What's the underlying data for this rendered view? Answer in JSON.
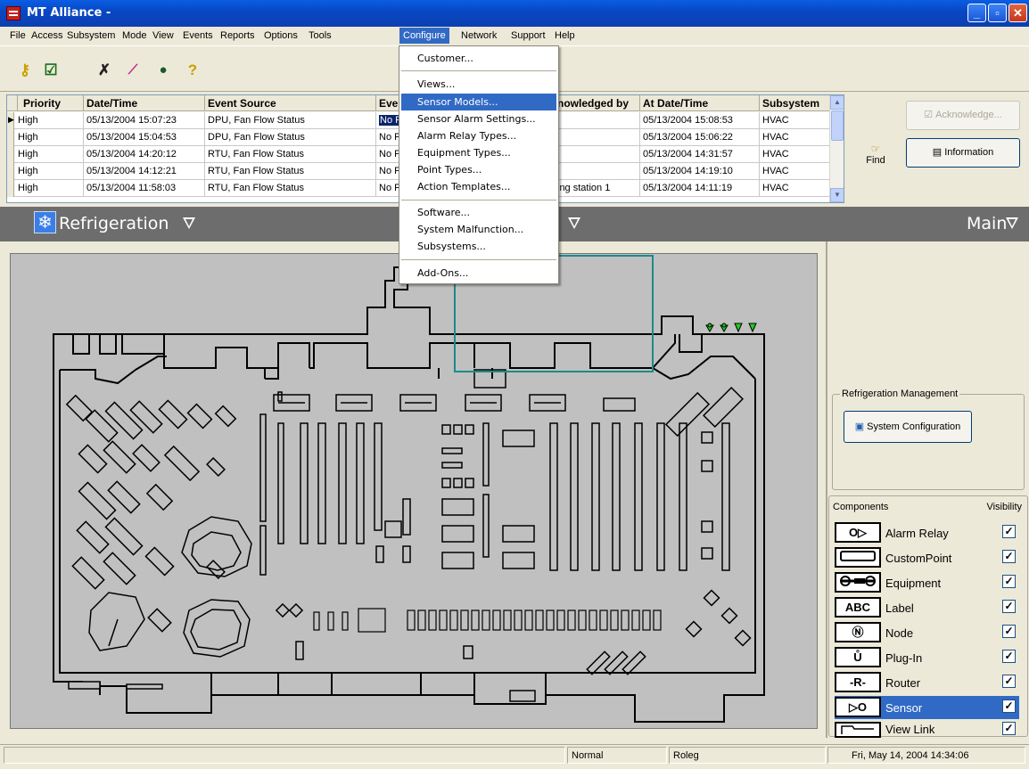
{
  "window": {
    "title": "MT Alliance -"
  },
  "menubar": {
    "items": [
      "File",
      "Access",
      "Subsystem",
      "Mode",
      "View",
      "Events",
      "Reports",
      "Options",
      "Tools",
      "Configure",
      "Network",
      "Support",
      "Help"
    ],
    "active": "Configure"
  },
  "toolbar": {
    "icons": [
      "key-icon",
      "checkmark-icon",
      "cross-icon",
      "trend-chart-icon",
      "globe-icon",
      "help-icon"
    ]
  },
  "event_grid": {
    "columns": [
      "Priority",
      "Date/Time",
      "Event Source",
      "Eve",
      "nowledged by",
      "At Date/Time",
      "Subsystem"
    ],
    "rows": [
      {
        "priority": "High",
        "datetime": "05/13/2004 15:07:23",
        "source": "DPU, Fan Flow Status",
        "event": "No F",
        "ack_by": "",
        "at_datetime": "05/13/2004 15:08:53",
        "subsystem": "HVAC"
      },
      {
        "priority": "High",
        "datetime": "05/13/2004 15:04:53",
        "source": "DPU, Fan Flow Status",
        "event": "No F",
        "ack_by": "",
        "at_datetime": "05/13/2004 15:06:22",
        "subsystem": "HVAC"
      },
      {
        "priority": "High",
        "datetime": "05/13/2004 14:20:12",
        "source": "RTU, Fan Flow Status",
        "event": "No F",
        "ack_by": "",
        "at_datetime": "05/13/2004 14:31:57",
        "subsystem": "HVAC"
      },
      {
        "priority": "High",
        "datetime": "05/13/2004 14:12:21",
        "source": "RTU, Fan Flow Status",
        "event": "No F",
        "ack_by": "",
        "at_datetime": "05/13/2004 14:19:10",
        "subsystem": "HVAC"
      },
      {
        "priority": "High",
        "datetime": "05/13/2004 11:58:03",
        "source": "RTU, Fan Flow Status",
        "event": "No F",
        "ack_by": "ing station 1",
        "at_datetime": "05/13/2004 14:11:19",
        "subsystem": "HVAC"
      }
    ]
  },
  "actions": {
    "acknowledge": "Acknowledge...",
    "information": "Information",
    "find": "Find"
  },
  "viewbar": {
    "left_view": "Refrigeration",
    "right_view": "Main"
  },
  "configure_menu": {
    "groups": [
      [
        "Customer..."
      ],
      [
        "Views...",
        "Sensor Models...",
        "Sensor Alarm Settings...",
        "Alarm Relay Types...",
        "Equipment Types...",
        "Point Types...",
        "Action Templates..."
      ],
      [
        "Software...",
        "System Malfunction...",
        "Subsystems..."
      ],
      [
        "Add-Ons..."
      ]
    ],
    "highlighted": "Sensor Models..."
  },
  "refrigeration_management": {
    "title": "Refrigeration Management",
    "system_configuration": "System Configuration"
  },
  "components": {
    "header_components": "Components",
    "header_visibility": "Visibility",
    "items": [
      {
        "label": "Alarm Relay",
        "icon": "alarm-relay-icon",
        "glyph": "O▷",
        "visible": true
      },
      {
        "label": "CustomPoint",
        "icon": "custom-point-icon",
        "glyph": "",
        "visible": true
      },
      {
        "label": "Equipment",
        "icon": "equipment-icon",
        "glyph": "",
        "visible": true
      },
      {
        "label": "Label",
        "icon": "label-icon",
        "glyph": "ABC",
        "visible": true
      },
      {
        "label": "Node",
        "icon": "node-icon",
        "glyph": "Ⓝ",
        "visible": true
      },
      {
        "label": "Plug-In",
        "icon": "plug-in-icon",
        "glyph": "Ů",
        "visible": true
      },
      {
        "label": "Router",
        "icon": "router-icon",
        "glyph": "-R-",
        "visible": true
      },
      {
        "label": "Sensor",
        "icon": "sensor-icon",
        "glyph": "▷O",
        "visible": true
      },
      {
        "label": "View Link",
        "icon": "view-link-icon",
        "glyph": "",
        "visible": true
      }
    ],
    "selected": "Sensor"
  },
  "statusbar": {
    "mode": "Normal",
    "user": "Roleg",
    "datetime": "Fri, May 14, 2004  14:34:06"
  },
  "colors": {
    "title_bar": "#0a5ee4",
    "menu_highlight": "#316ac5",
    "viewbar": "#6d6d6d",
    "plan_background": "#c0c0c0",
    "alarm_marker": "#22cc22",
    "teal_selection": "#1e8a8a"
  }
}
